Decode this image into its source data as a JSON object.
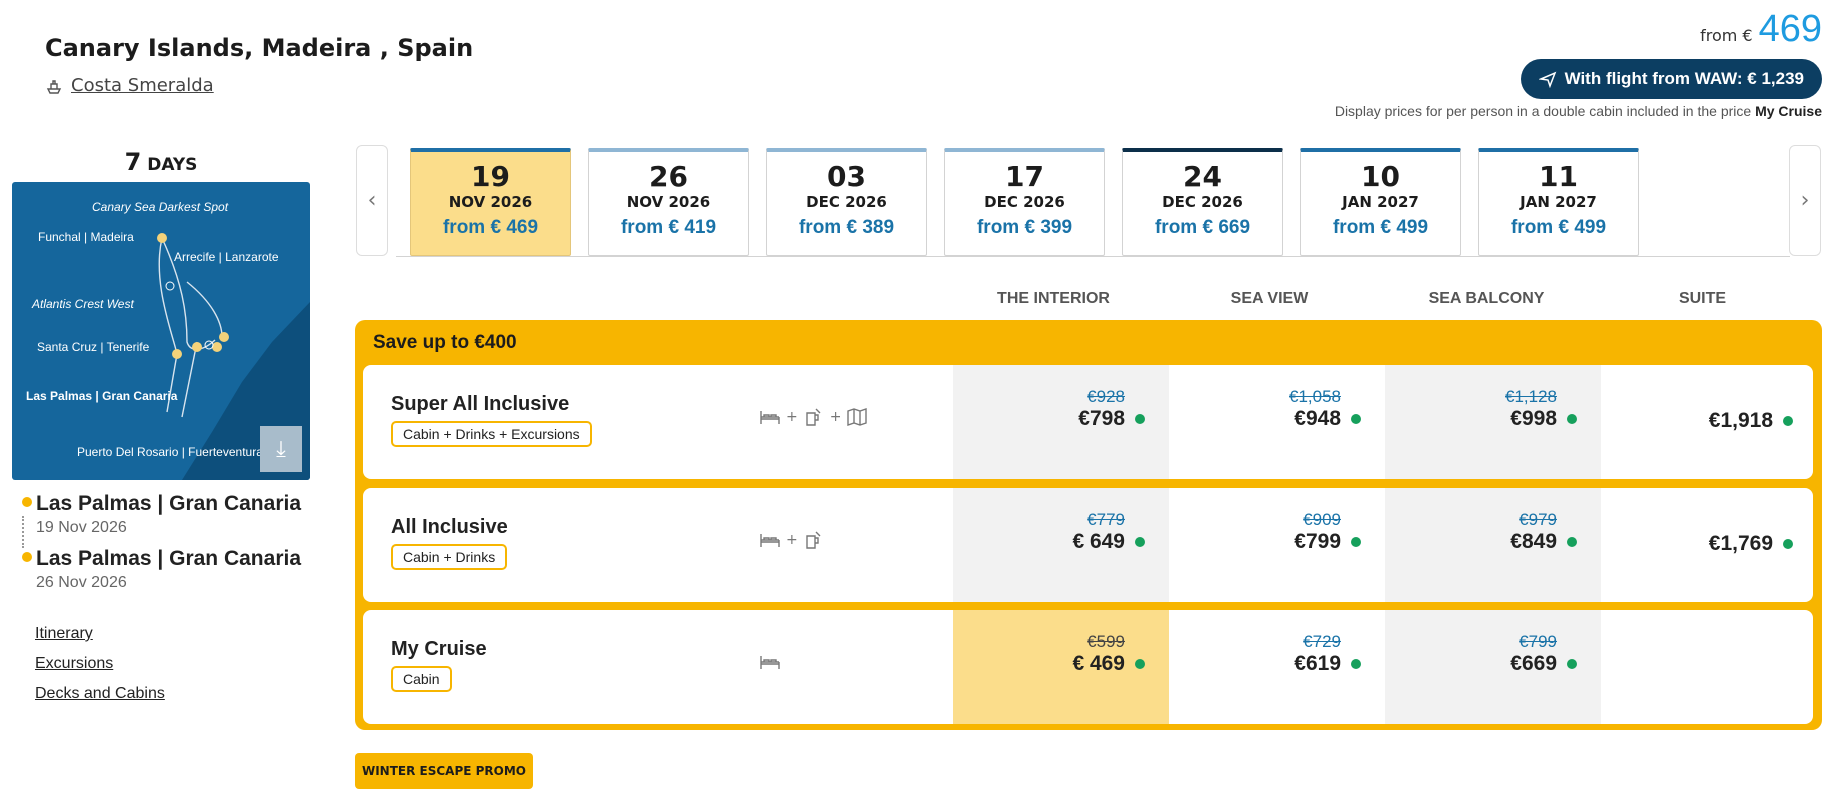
{
  "header": {
    "title": "Canary Islands, Madeira , Spain",
    "ship": "Costa Smeralda"
  },
  "price": {
    "from_label": "from €",
    "value": "469",
    "flight_label": "With flight from WAW: € 1,239",
    "disclaimer": "Display prices for per person in a double cabin included in the price",
    "disclaimer_bold": "My Cruise"
  },
  "trip": {
    "days_num": "7",
    "days_label": "DAYS"
  },
  "map": {
    "labels": [
      "Canary Sea Darkest Spot",
      "Funchal | Madeira",
      "Arrecife | Lanzarote",
      "Atlantis Crest West",
      "Santa Cruz | Tenerife",
      "Las Palmas | Gran Canaria",
      "Puerto Del Rosario | Fuerteventura"
    ]
  },
  "ports": [
    {
      "name": "Las Palmas | Gran Canaria",
      "date": "19 Nov 2026"
    },
    {
      "name": "Las Palmas | Gran Canaria",
      "date": "26 Nov 2026"
    }
  ],
  "sidelinks": [
    "Itinerary",
    "Excursions",
    "Decks and Cabins"
  ],
  "dates": [
    {
      "day": "19",
      "month": "NOV 2026",
      "price": "from € 469"
    },
    {
      "day": "26",
      "month": "NOV 2026",
      "price": "from € 419"
    },
    {
      "day": "03",
      "month": "DEC 2026",
      "price": "from € 389"
    },
    {
      "day": "17",
      "month": "DEC 2026",
      "price": "from € 399"
    },
    {
      "day": "24",
      "month": "DEC 2026",
      "price": "from € 669"
    },
    {
      "day": "10",
      "month": "JAN 2027",
      "price": "from € 499"
    },
    {
      "day": "11",
      "month": "JAN 2027",
      "price": "from € 499"
    }
  ],
  "columns": [
    "THE INTERIOR",
    "SEA VIEW",
    "SEA BALCONY",
    "SUITE"
  ],
  "promo": {
    "title": "Save up to €400",
    "badge": "WINTER ESCAPE PROMO"
  },
  "packages": [
    {
      "name": "Super All Inclusive",
      "badge": "Cabin + Drinks + Excursions",
      "prices": [
        {
          "old": "€928",
          "now": "€798"
        },
        {
          "old": "€1,058",
          "now": "€948"
        },
        {
          "old": "€1,128",
          "now": "€998"
        },
        {
          "old": "",
          "now": "€1,918"
        }
      ]
    },
    {
      "name": "All Inclusive",
      "badge": "Cabin + Drinks",
      "prices": [
        {
          "old": "€779",
          "now": "€ 649"
        },
        {
          "old": "€909",
          "now": "€799"
        },
        {
          "old": "€979",
          "now": "€849"
        },
        {
          "old": "",
          "now": "€1,769"
        }
      ]
    },
    {
      "name": "My Cruise",
      "badge": "Cabin",
      "prices": [
        {
          "old": "€599",
          "now": "€ 469"
        },
        {
          "old": "€729",
          "now": "€619"
        },
        {
          "old": "€799",
          "now": "€669"
        }
      ]
    }
  ],
  "colors": {
    "accent": "#f7b500",
    "link_blue": "#1a73a8",
    "dark_blue": "#0c3e62",
    "available": "#16a05c"
  }
}
